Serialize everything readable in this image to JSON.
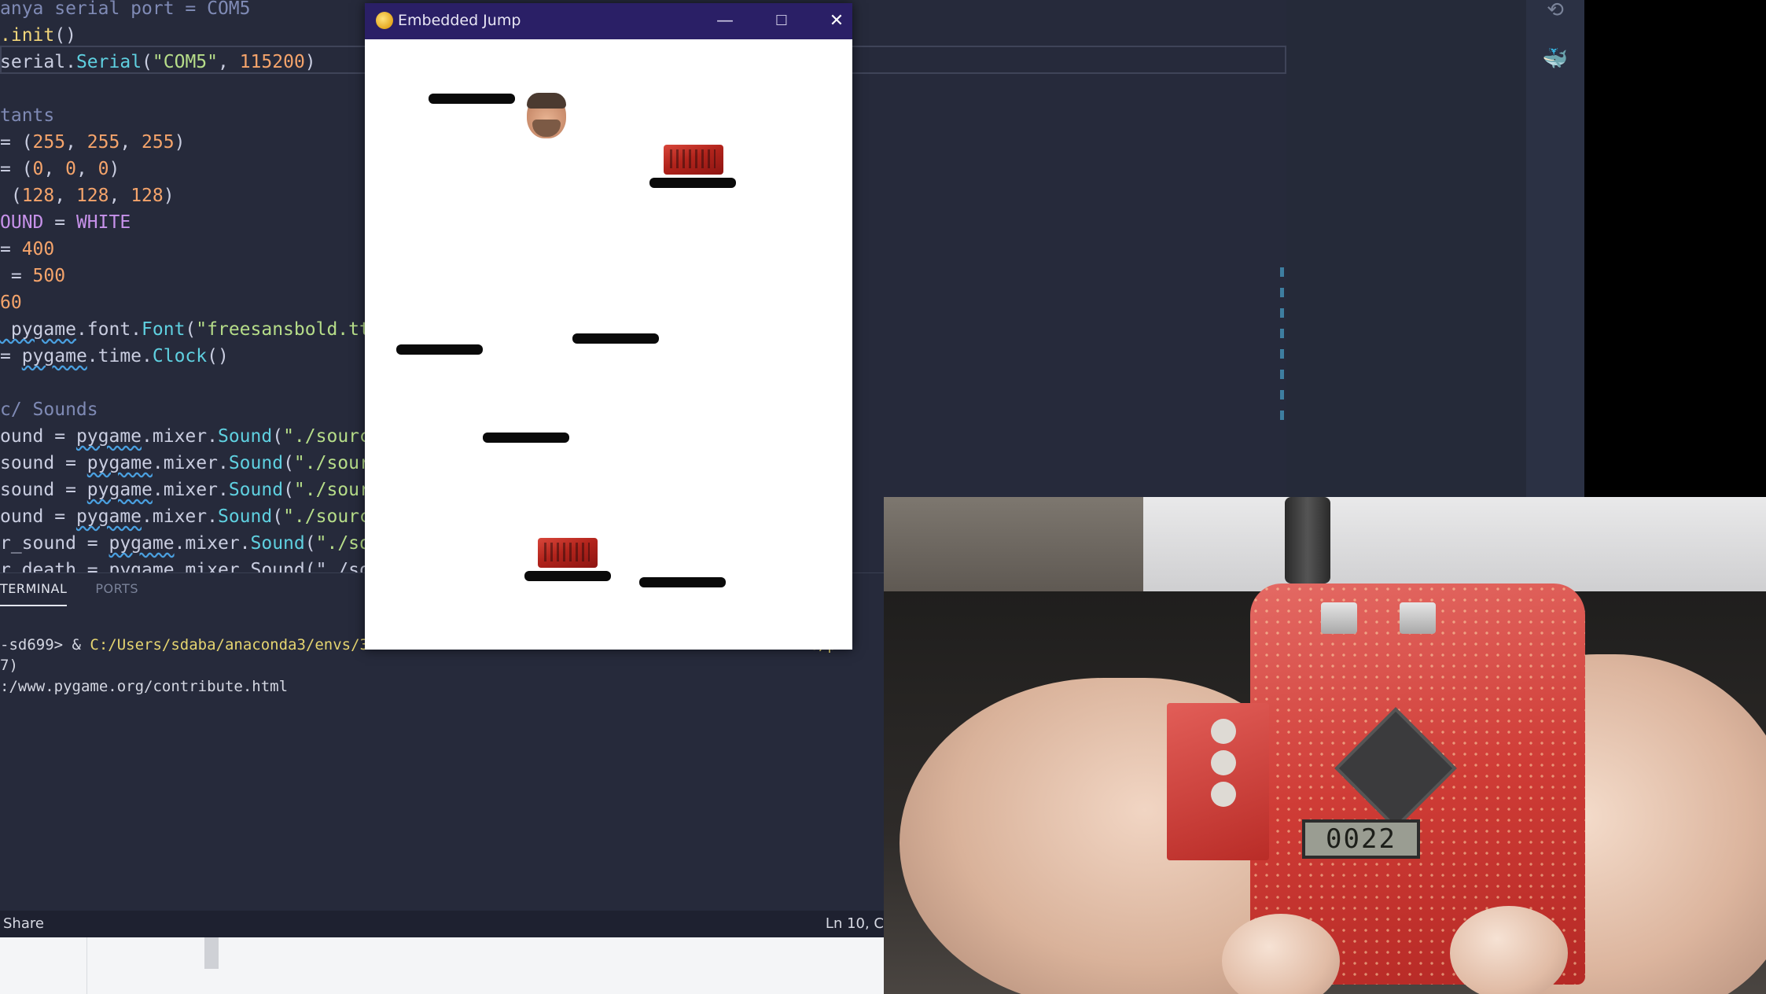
{
  "editor": {
    "lines": [
      [
        {
          "t": "anya serial port = COM5",
          "c": "kw-comment"
        }
      ],
      [
        {
          "t": ".init",
          "c": "kw-fn"
        },
        {
          "t": "()",
          "c": ""
        }
      ],
      [
        {
          "t": "serial",
          "c": ""
        },
        {
          "t": ".",
          "c": ""
        },
        {
          "t": "Serial",
          "c": "kw-cls"
        },
        {
          "t": "(",
          "c": ""
        },
        {
          "t": "\"COM5\"",
          "c": "kw-str"
        },
        {
          "t": ", ",
          "c": ""
        },
        {
          "t": "115200",
          "c": "kw-num"
        },
        {
          "t": ")",
          "c": ""
        }
      ],
      [
        {
          "t": "",
          "c": ""
        }
      ],
      [
        {
          "t": "tants",
          "c": "kw-comment"
        }
      ],
      [
        {
          "t": "= (",
          "c": ""
        },
        {
          "t": "255",
          "c": "kw-num"
        },
        {
          "t": ", ",
          "c": ""
        },
        {
          "t": "255",
          "c": "kw-num"
        },
        {
          "t": ", ",
          "c": ""
        },
        {
          "t": "255",
          "c": "kw-num"
        },
        {
          "t": ")",
          "c": ""
        }
      ],
      [
        {
          "t": "= (",
          "c": ""
        },
        {
          "t": "0",
          "c": "kw-num"
        },
        {
          "t": ", ",
          "c": ""
        },
        {
          "t": "0",
          "c": "kw-num"
        },
        {
          "t": ", ",
          "c": ""
        },
        {
          "t": "0",
          "c": "kw-num"
        },
        {
          "t": ")",
          "c": ""
        }
      ],
      [
        {
          "t": " (",
          "c": ""
        },
        {
          "t": "128",
          "c": "kw-num"
        },
        {
          "t": ", ",
          "c": ""
        },
        {
          "t": "128",
          "c": "kw-num"
        },
        {
          "t": ", ",
          "c": ""
        },
        {
          "t": "128",
          "c": "kw-num"
        },
        {
          "t": ")",
          "c": ""
        }
      ],
      [
        {
          "t": "OUND",
          "c": "kw-const"
        },
        {
          "t": " = ",
          "c": ""
        },
        {
          "t": "WHITE",
          "c": "kw-const"
        }
      ],
      [
        {
          "t": "= ",
          "c": ""
        },
        {
          "t": "400",
          "c": "kw-num"
        }
      ],
      [
        {
          "t": " = ",
          "c": ""
        },
        {
          "t": "500",
          "c": "kw-num"
        }
      ],
      [
        {
          "t": "60",
          "c": "kw-num"
        }
      ],
      [
        {
          "t": " pygame",
          "c": "kw-ul"
        },
        {
          "t": ".font.",
          "c": ""
        },
        {
          "t": "Font",
          "c": "kw-cls"
        },
        {
          "t": "(",
          "c": ""
        },
        {
          "t": "\"freesansbold.tt",
          "c": "kw-str"
        }
      ],
      [
        {
          "t": "= ",
          "c": ""
        },
        {
          "t": "pygame",
          "c": "kw-ul"
        },
        {
          "t": ".time.",
          "c": ""
        },
        {
          "t": "Clock",
          "c": "kw-cls"
        },
        {
          "t": "()",
          "c": ""
        }
      ],
      [
        {
          "t": "",
          "c": ""
        }
      ],
      [
        {
          "t": "c/ Sounds",
          "c": "kw-comment"
        }
      ],
      [
        {
          "t": "ound = ",
          "c": ""
        },
        {
          "t": "pygame",
          "c": "kw-ul"
        },
        {
          "t": ".mixer.",
          "c": ""
        },
        {
          "t": "Sound",
          "c": "kw-cls"
        },
        {
          "t": "(",
          "c": ""
        },
        {
          "t": "\"./source",
          "c": "kw-str"
        }
      ],
      [
        {
          "t": "sound = ",
          "c": ""
        },
        {
          "t": "pygame",
          "c": "kw-ul"
        },
        {
          "t": ".mixer.",
          "c": ""
        },
        {
          "t": "Sound",
          "c": "kw-cls"
        },
        {
          "t": "(",
          "c": ""
        },
        {
          "t": "\"./sour",
          "c": "kw-str"
        }
      ],
      [
        {
          "t": "sound = ",
          "c": ""
        },
        {
          "t": "pygame",
          "c": "kw-ul"
        },
        {
          "t": ".mixer.",
          "c": ""
        },
        {
          "t": "Sound",
          "c": "kw-cls"
        },
        {
          "t": "(",
          "c": ""
        },
        {
          "t": "\"./sour",
          "c": "kw-str"
        }
      ],
      [
        {
          "t": "ound = ",
          "c": ""
        },
        {
          "t": "pygame",
          "c": "kw-ul"
        },
        {
          "t": ".mixer.",
          "c": ""
        },
        {
          "t": "Sound",
          "c": "kw-cls"
        },
        {
          "t": "(",
          "c": ""
        },
        {
          "t": "\"./source",
          "c": "kw-str"
        }
      ],
      [
        {
          "t": "r_sound = ",
          "c": ""
        },
        {
          "t": "pygame",
          "c": "kw-ul"
        },
        {
          "t": ".mixer.",
          "c": ""
        },
        {
          "t": "Sound",
          "c": "kw-cls"
        },
        {
          "t": "(",
          "c": ""
        },
        {
          "t": "\"./so",
          "c": "kw-str"
        }
      ],
      [
        {
          "t": "r_death = pygame.mixer.Sound(\"./so",
          "c": ""
        }
      ]
    ]
  },
  "activity_bar": {
    "icons": [
      "remote-icon",
      "docker-icon"
    ]
  },
  "panel": {
    "tabs": [
      "TERMINAL",
      "PORTS"
    ],
    "active_tab": "TERMINAL",
    "terminal_lines": [
      [
        {
          "t": "-sd699> & ",
          "c": ""
        },
        {
          "t": "C:/Users/sdaba/anaconda3/envs/3",
          "c": "term-path"
        },
        {
          "t": "                                                 ",
          "c": ""
        },
        {
          "t": "e/p",
          "c": "term-path"
        }
      ],
      [
        {
          "t": "7)",
          "c": ""
        }
      ],
      [
        {
          "t": ":/www.pygame.org/contribute.html",
          "c": ""
        }
      ]
    ]
  },
  "statusbar": {
    "left": "Share",
    "right": "Ln 10, C"
  },
  "game_window": {
    "title": "Embedded Jump",
    "controls": {
      "minimize": "—",
      "maximize": "☐",
      "close": "✕"
    },
    "accent_color": "#2a1f66"
  },
  "webcam": {
    "lcd_display": "0022"
  }
}
